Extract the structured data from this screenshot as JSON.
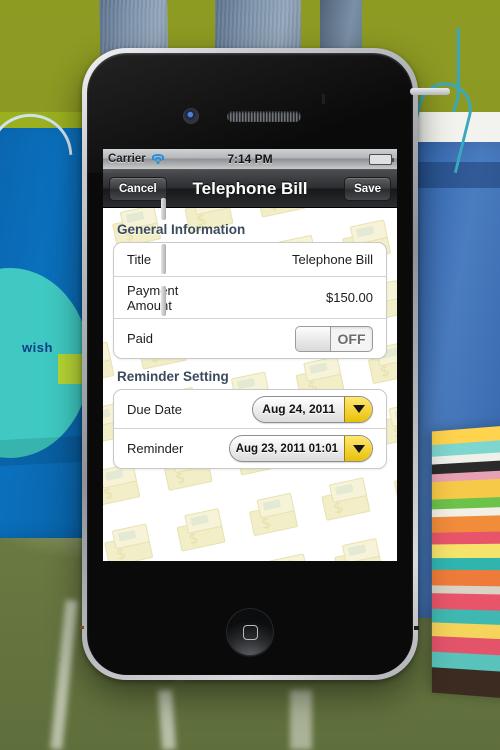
{
  "device": {
    "name": "iphone-4",
    "camera_icon": "camera-icon",
    "speaker_icon": "earpiece-speaker-icon",
    "home_button_icon": "home-button-icon"
  },
  "status_bar": {
    "carrier": "Carrier",
    "wifi_icon": "wifi-icon",
    "time": "7:14 PM",
    "battery_icon": "battery-full-icon",
    "battery_color": "#3faa2c"
  },
  "nav_bar": {
    "cancel_label": "Cancel",
    "title": "Telephone Bill",
    "save_label": "Save"
  },
  "sections": [
    {
      "title": "General Information",
      "rows": [
        {
          "label": "Title",
          "value": "Telephone Bill",
          "type": "text"
        },
        {
          "label": "Payment\nAmount",
          "value": "$150.00",
          "type": "text"
        },
        {
          "label": "Paid",
          "value": "OFF",
          "type": "toggle",
          "state": "off"
        }
      ]
    },
    {
      "title": "Reminder Setting",
      "rows": [
        {
          "label": "Due Date",
          "value": "Aug 24, 2011",
          "type": "dropdown"
        },
        {
          "label": "Reminder",
          "value": "Aug 23, 2011 01:01",
          "type": "dropdown"
        }
      ]
    }
  ],
  "theme": {
    "accent_yellow": "#e8c107",
    "section_header_color": "#3b4a5c",
    "toggle_label_color": "#6d6d6d"
  },
  "background": {
    "description": "photo of person in jeans standing on mossy ground with shopping bags",
    "bag_left_text": "wish",
    "grass_color": "#8e9b23",
    "bag_left_color": "#0a70bd",
    "bag_right_color": "#4a7cc0"
  },
  "content_pattern": {
    "name": "banknote-pattern",
    "color": "#efeab4"
  }
}
